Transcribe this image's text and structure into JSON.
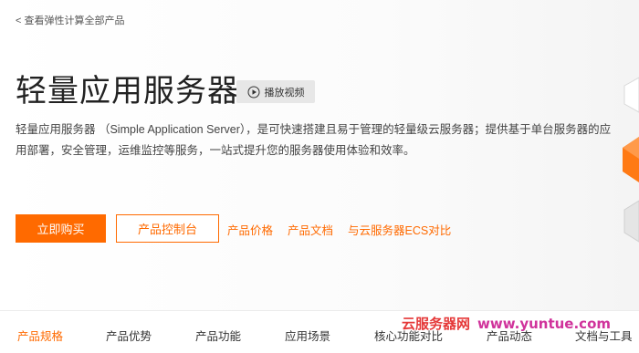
{
  "back_link": "< 查看弹性计算全部产品",
  "title": "轻量应用服务器",
  "video_button": "播放视频",
  "description": "轻量应用服务器 （Simple Application Server），是可快速搭建且易于管理的轻量级云服务器；提供基于单台服务器的应用部署，安全管理，运维监控等服务，一站式提升您的服务器使用体验和效率。",
  "actions": {
    "buy": "立即购买",
    "console": "产品控制台",
    "price": "产品价格",
    "docs": "产品文档",
    "compare": "与云服务器ECS对比"
  },
  "tabs": [
    "产品规格",
    "产品优势",
    "产品功能",
    "应用场景",
    "核心功能对比",
    "产品动态",
    "文档与工具"
  ],
  "active_tab": "产品规格",
  "watermark": {
    "name": "云服务器网",
    "url": "www.yuntue.com"
  },
  "colors": {
    "accent": "#ff6a00",
    "watermark_red": "#e53939",
    "watermark_pink": "#d0339b"
  }
}
